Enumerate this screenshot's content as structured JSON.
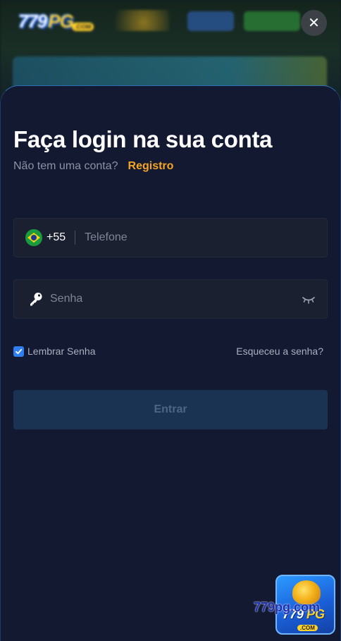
{
  "background": {
    "logo": {
      "number": "779",
      "letters": "PG",
      "domain": ".COM"
    }
  },
  "login": {
    "title": "Faça login na sua conta",
    "no_account_text": "Não tem uma conta?",
    "register_link": "Registro",
    "phone": {
      "country_code": "+55",
      "placeholder": "Telefone",
      "flag_icon": "brazil-flag-icon"
    },
    "password": {
      "placeholder": "Senha",
      "key_icon": "key-icon",
      "visibility_icon": "eye-closed-icon"
    },
    "remember_label": "Lembrar Senha",
    "remember_checked": true,
    "forgot_link": "Esqueceu a senha?",
    "submit_label": "Entrar"
  },
  "badge": {
    "number": "779",
    "letters": "PG",
    "domain": ".COM",
    "watermark": "779pg.com"
  },
  "colors": {
    "sheet_bg": "#131931",
    "accent_link": "#f5a524",
    "checkbox": "#2f7ff0",
    "submit_bg": "#1b3352"
  }
}
